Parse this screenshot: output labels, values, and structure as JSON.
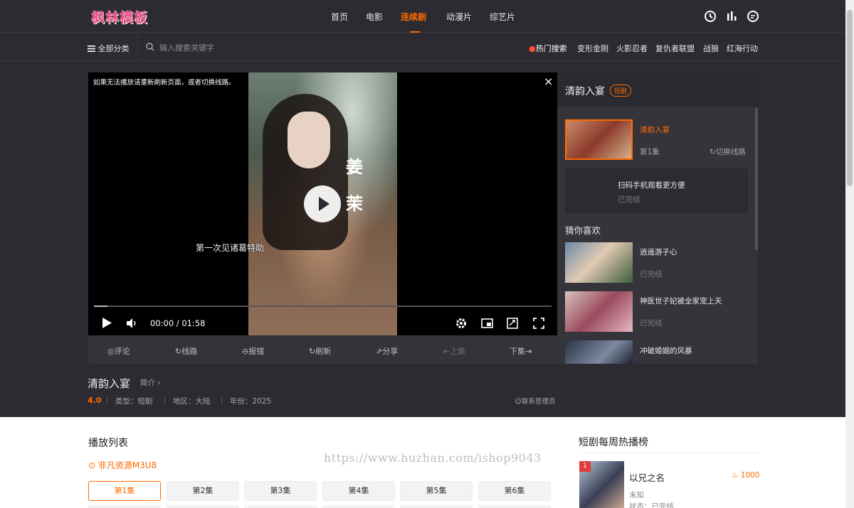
{
  "logo": "枫林模板",
  "nav": [
    {
      "label": "首页",
      "active": false
    },
    {
      "label": "电影",
      "active": false
    },
    {
      "label": "连续剧",
      "active": true
    },
    {
      "label": "动漫片",
      "active": false
    },
    {
      "label": "综艺片",
      "active": false
    }
  ],
  "top_icons": [
    "history-icon",
    "ranking-icon",
    "message-icon"
  ],
  "search": {
    "all_categories": "全部分类",
    "placeholder": "输入搜索关键字",
    "hot_label": "热门搜索",
    "hot_terms": [
      "变形金刚",
      "火影忍者",
      "复仇者联盟",
      "战狼",
      "红海行动"
    ]
  },
  "player": {
    "notice": "如果无法播放请重新刷新页面，或者切换线路。",
    "close": "×",
    "overlay_title_1": "姜",
    "overlay_title_2": "茉",
    "overlay_caption": "第一次见诸葛特助",
    "current_time": "00:00",
    "duration": "01:58",
    "time_display": "00:00 / 01:58",
    "progress": 0.03
  },
  "actions": [
    {
      "label": "评论",
      "icon": "comment-icon",
      "enabled": true
    },
    {
      "label": "线路",
      "icon": "route-icon",
      "enabled": true
    },
    {
      "label": "报错",
      "icon": "report-icon",
      "enabled": true
    },
    {
      "label": "刷新",
      "icon": "refresh-icon",
      "enabled": true
    },
    {
      "label": "分享",
      "icon": "share-icon",
      "enabled": true
    },
    {
      "label": "上集",
      "icon": "prev-icon",
      "enabled": false
    },
    {
      "label": "下集",
      "icon": "next-icon",
      "enabled": true
    }
  ],
  "side": {
    "title": "清韵入宴",
    "badge": "短剧",
    "current_episode": {
      "title": "清韵入宴",
      "episode": "第1集",
      "switch": "切换线路"
    },
    "qr": {
      "title": "扫码手机观看更方便",
      "status": "已完结"
    },
    "recommend_heading": "猜你喜欢",
    "recommend": [
      {
        "title": "逍遥游子心",
        "status": "已完结"
      },
      {
        "title": "神医世子妃被全家宠上天",
        "status": "已完结"
      },
      {
        "title": "冲破婚姻的风暴",
        "status": ""
      }
    ]
  },
  "detail": {
    "title": "清韵入宴",
    "intro": "简介",
    "rating": "4.0",
    "type": "类型：短剧",
    "region": "地区：大陆",
    "year": "年份：2025",
    "contact": "联系管理员"
  },
  "playlist": {
    "title": "播放列表",
    "source": "非凡资源M3U8",
    "episodes": [
      "第1集",
      "第2集",
      "第3集",
      "第4集",
      "第5集",
      "第6集"
    ],
    "active_index": 0
  },
  "watermark": "https://www.huzhan.com/ishop9043",
  "hot": {
    "title": "短剧每周热播榜",
    "items": [
      {
        "rank": "1",
        "name": "以兄之名",
        "score": "1000",
        "sub": "未知",
        "status": "状态：已完结"
      }
    ]
  },
  "colors": {
    "accent": "#ff6a00",
    "bg_dark": "#2c2b31",
    "panel": "#35343b"
  }
}
